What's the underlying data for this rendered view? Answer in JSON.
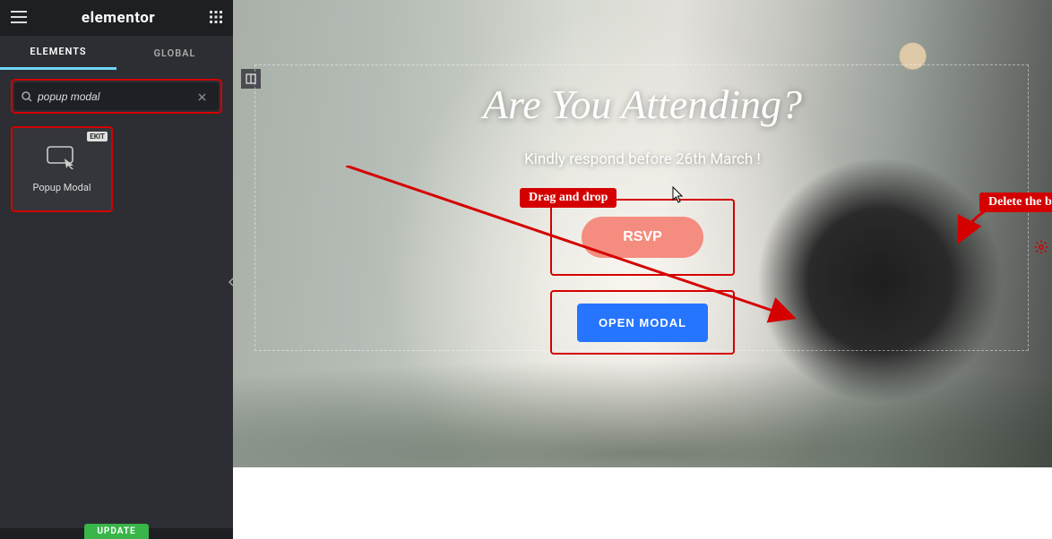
{
  "app": {
    "logo": "elementor"
  },
  "tabs": {
    "elements": "ELEMENTS",
    "global": "GLOBAL"
  },
  "search": {
    "value": "popup modal"
  },
  "widget": {
    "badge": "EKIT",
    "label": "Popup Modal"
  },
  "bottombar": {
    "update": "UPDATE"
  },
  "canvas": {
    "title": "Are You Attending?",
    "subtitle": "Kindly respond before 26th March !",
    "rsvp": "RSVP",
    "open_modal": "OPEN MODAL"
  },
  "annotations": {
    "drag": "Drag and drop",
    "delete": "Delete the button"
  }
}
